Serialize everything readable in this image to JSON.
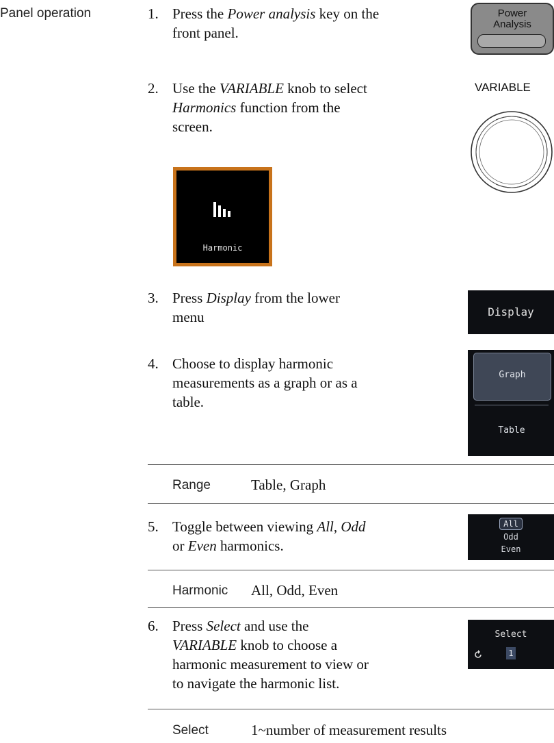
{
  "section_label": "Panel operation",
  "steps": [
    {
      "num": "1.",
      "lines": [
        "Press the <i>Power analysis</i> key on the",
        "front panel."
      ]
    },
    {
      "num": "2.",
      "lines": [
        "Use the <i>VARIABLE</i> knob to select",
        "<i>Harmonics</i> function from the",
        "screen."
      ]
    },
    {
      "num": "3.",
      "lines": [
        "Press <i>Display</i> from the lower",
        "menu"
      ]
    },
    {
      "num": "4.",
      "lines": [
        "Choose to display harmonic",
        "measurements as a graph or as a",
        "table."
      ]
    },
    {
      "num": "5.",
      "lines": [
        "Toggle between viewing <i>All</i>, <i>Odd</i>",
        "or <i>Even</i> harmonics."
      ]
    },
    {
      "num": "6.",
      "lines": [
        "Press <i>Select</i> and use the",
        "<i>VARIABLE</i> knob to choose a",
        "harmonic measurement to view or",
        "to navigate the harmonic list."
      ]
    }
  ],
  "params": [
    {
      "label": "Range",
      "value": "Table, Graph"
    },
    {
      "label": "Harmonic",
      "value": "All, Odd, Even"
    },
    {
      "label": "Select",
      "value": "1~number of measurement results"
    }
  ],
  "power_key": {
    "line1": "Power",
    "line2": "Analysis"
  },
  "variable_label": "VARIABLE",
  "harmonic_tile": {
    "label": "Harmonic",
    "border_color": "#c8731b"
  },
  "display_softkey": {
    "label": "Display"
  },
  "graph_table_menu": {
    "option1": "Graph",
    "option2": "Table"
  },
  "harmonic_filter_menu": {
    "options": [
      "All",
      "Odd",
      "Even"
    ],
    "selected": "All"
  },
  "select_softkey": {
    "label": "Select",
    "value": "1"
  }
}
